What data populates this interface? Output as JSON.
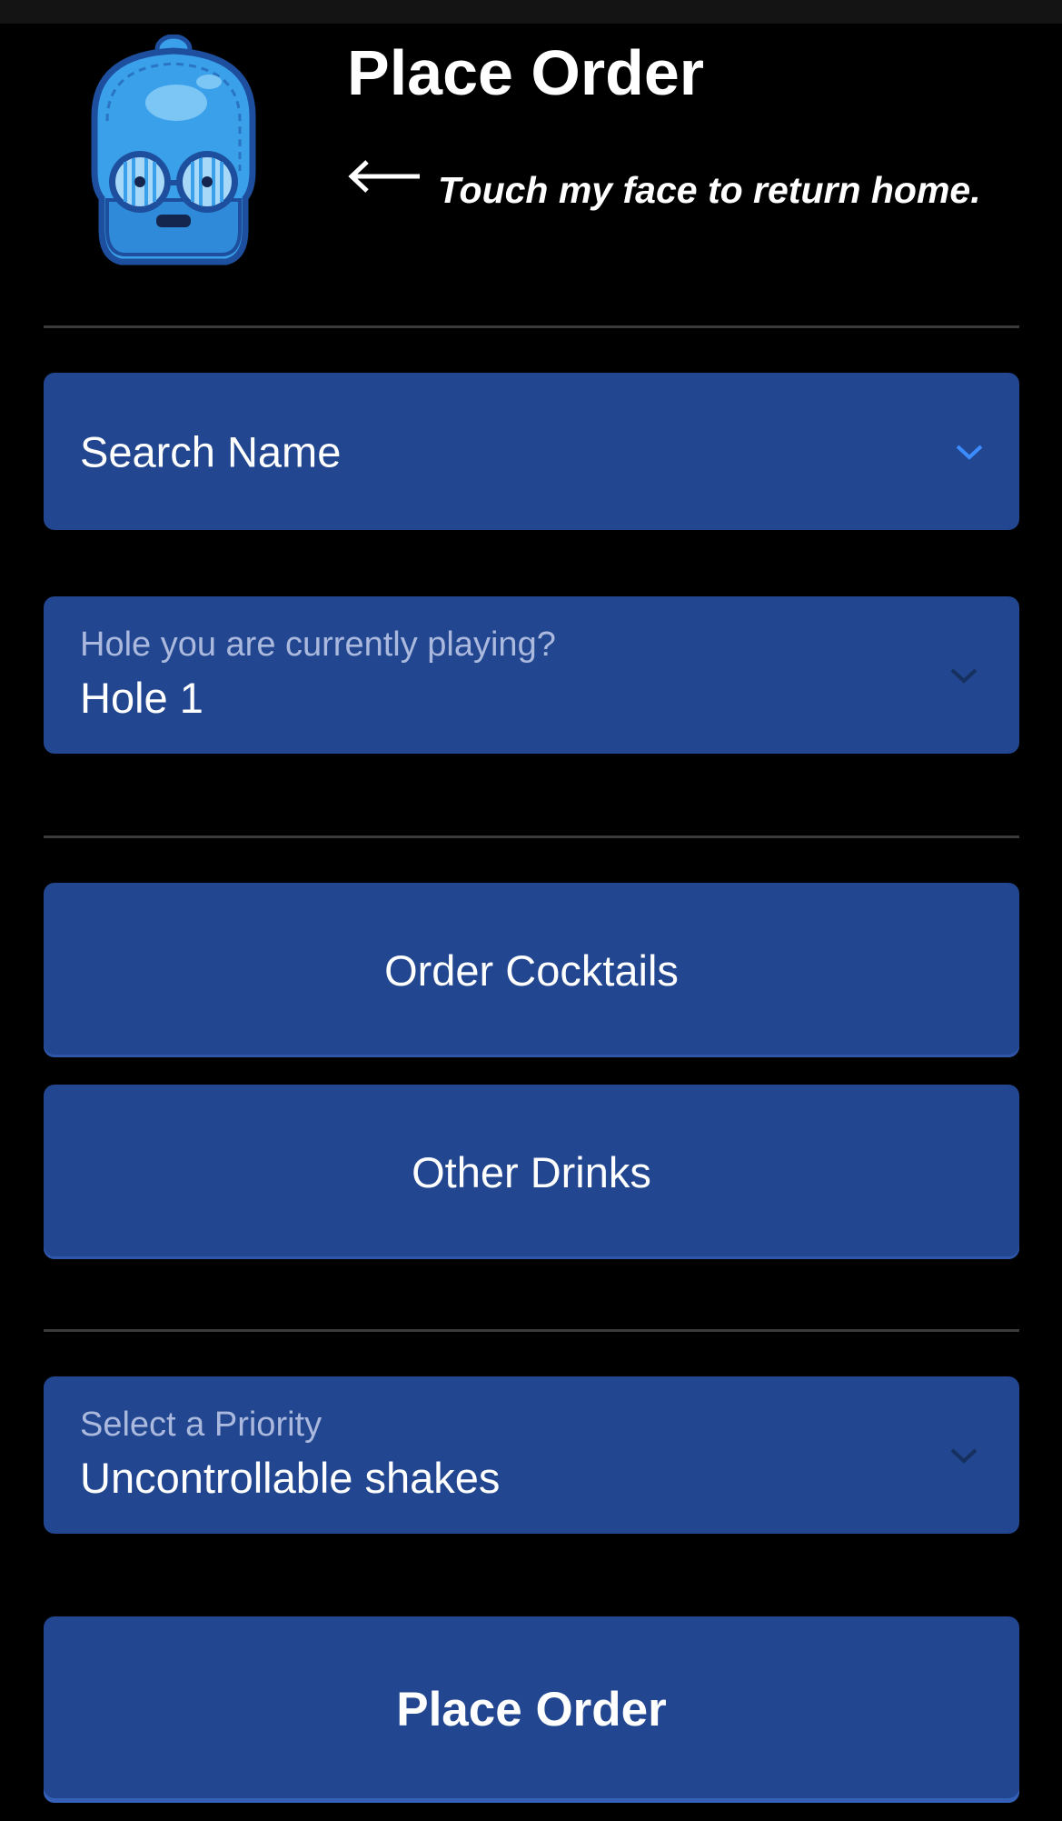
{
  "header": {
    "title": "Place Order",
    "back_hint": "Touch my face to return home.",
    "avatar_icon": "droid-face-icon",
    "back_icon": "left-arrow-icon"
  },
  "form": {
    "name_select": {
      "value": "Search Name",
      "icon": "chevron-down-icon"
    },
    "hole_select": {
      "label": "Hole you are currently playing?",
      "value": "Hole 1",
      "icon": "chevron-down-icon"
    },
    "priority_select": {
      "label": "Select a Priority",
      "value": "Uncontrollable shakes",
      "icon": "chevron-down-icon"
    }
  },
  "buttons": {
    "cocktails": "Order Cocktails",
    "other_drinks": "Other Drinks",
    "place_order": "Place Order"
  },
  "colors": {
    "background": "#000000",
    "field": "#22468f",
    "accent_chevron": "#3b8cff",
    "muted_chevron": "#16305f",
    "divider": "#3b3b3b"
  }
}
